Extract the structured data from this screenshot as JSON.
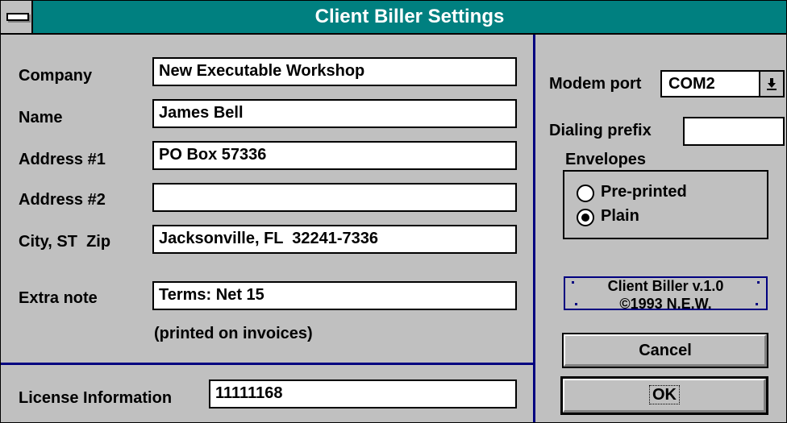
{
  "window": {
    "title": "Client Biller Settings"
  },
  "fields": {
    "company": {
      "label": "Company",
      "value": "New Executable Workshop"
    },
    "name": {
      "label": "Name",
      "value": "James Bell"
    },
    "address1": {
      "label": "Address #1",
      "value": "PO Box 57336"
    },
    "address2": {
      "label": "Address #2",
      "value": ""
    },
    "city": {
      "label": "City, ST  Zip",
      "value": "Jacksonville, FL  32241-7336"
    },
    "extra_note": {
      "label": "Extra note",
      "value": "Terms: Net 15",
      "hint": "(printed on invoices)"
    }
  },
  "license": {
    "label": "License Information",
    "value": "11111168"
  },
  "modem": {
    "label": "Modem port",
    "selected": "COM2",
    "dropdown_icon": "arrow-down-underline-icon"
  },
  "dialing": {
    "label": "Dialing prefix",
    "value": ""
  },
  "envelopes": {
    "label": "Envelopes",
    "options": [
      {
        "label": "Pre-printed",
        "selected": false
      },
      {
        "label": "Plain",
        "selected": true
      }
    ]
  },
  "about": {
    "line1": "Client Biller v.1.0",
    "line2": "©1993 N.E.W."
  },
  "buttons": {
    "cancel": "Cancel",
    "ok": "OK"
  },
  "colors": {
    "titlebar": "#008080",
    "face": "#c0c0c0",
    "divider": "#000080"
  }
}
